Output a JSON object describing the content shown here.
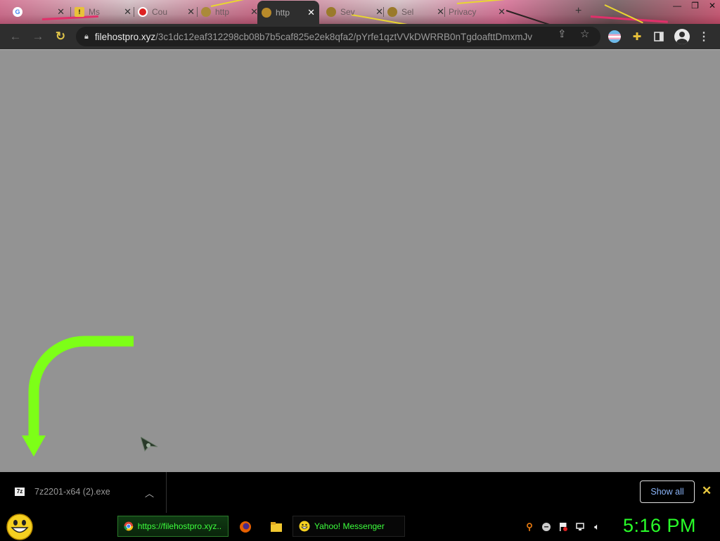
{
  "browser": {
    "tabs": [
      {
        "title": "",
        "favicon": "google-icon"
      },
      {
        "title": "Ms",
        "favicon": "warning-icon"
      },
      {
        "title": "Cou",
        "favicon": "opera-icon"
      },
      {
        "title": "http",
        "favicon": "page-icon"
      },
      {
        "title": "http",
        "favicon": "globe-icon",
        "active": true
      },
      {
        "title": "Sev",
        "favicon": "globe-icon"
      },
      {
        "title": "Sel",
        "favicon": "globe-icon"
      },
      {
        "title": "Privacy",
        "favicon": "page-icon"
      }
    ],
    "new_tab": "+",
    "url_host": "filehostpro.xyz",
    "url_path": "/3c1dc12eaf312298cb08b7b5caf825e2ek8qfa2/pYrfe1qztVVkDWRRB0nTgdoafttDmxmJv"
  },
  "download_bar": {
    "file_name": "7z2201-x64 (2).exe",
    "file_icon_text": "7z",
    "show_all_label": "Show all",
    "close_label": "✕"
  },
  "taskbar": {
    "chrome_task_label": "https://filehostpro.xyz...",
    "yahoo_task_label": "Yahoo! Messenger",
    "clock": "5:16 PM"
  },
  "colors": {
    "page_background": "#939393",
    "arrow": "#7dff17",
    "clock": "#29ff29",
    "link_blue": "#8ab4f8"
  }
}
